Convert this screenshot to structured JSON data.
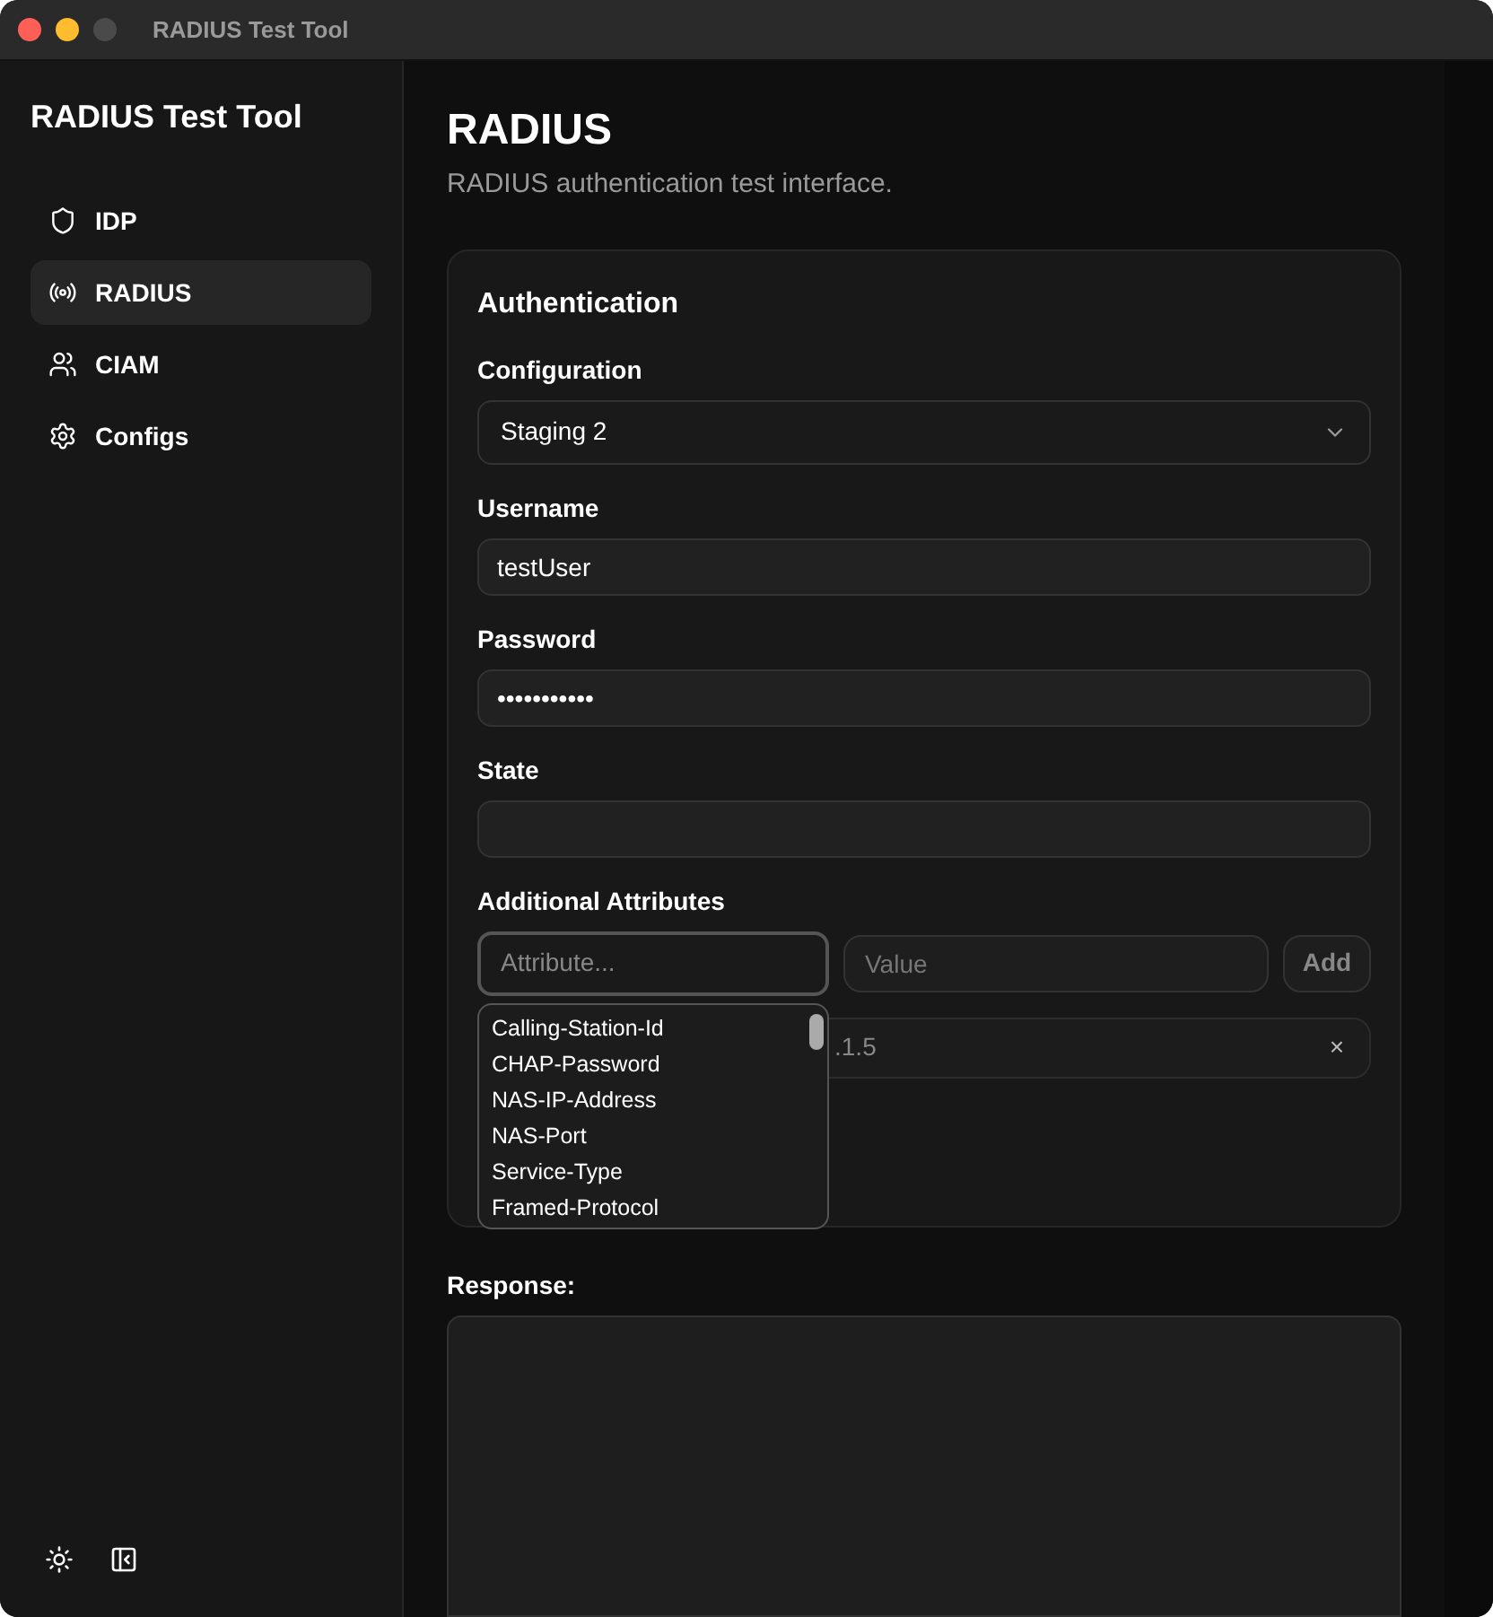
{
  "window": {
    "title": "RADIUS Test Tool"
  },
  "sidebar": {
    "title": "RADIUS Test Tool",
    "items": [
      {
        "label": "IDP",
        "selected": false
      },
      {
        "label": "RADIUS",
        "selected": true
      },
      {
        "label": "CIAM",
        "selected": false
      },
      {
        "label": "Configs",
        "selected": false
      }
    ]
  },
  "page": {
    "title": "RADIUS",
    "subtitle": "RADIUS authentication test interface."
  },
  "form": {
    "title": "Authentication",
    "configuration": {
      "label": "Configuration",
      "value": "Staging 2"
    },
    "username": {
      "label": "Username",
      "value": "testUser"
    },
    "password": {
      "label": "Password",
      "value": "•••••••••••"
    },
    "state": {
      "label": "State"
    },
    "additional": {
      "label": "Additional Attributes",
      "attribute_placeholder": "Attribute...",
      "value_placeholder": "Value",
      "add_button": "Add",
      "added": [
        {
          "text": ".1.5",
          "remove": "×"
        }
      ],
      "suggestions": [
        "Calling-Station-Id",
        "CHAP-Password",
        "NAS-IP-Address",
        "NAS-Port",
        "Service-Type",
        "Framed-Protocol"
      ]
    }
  },
  "response": {
    "label": "Response:"
  }
}
